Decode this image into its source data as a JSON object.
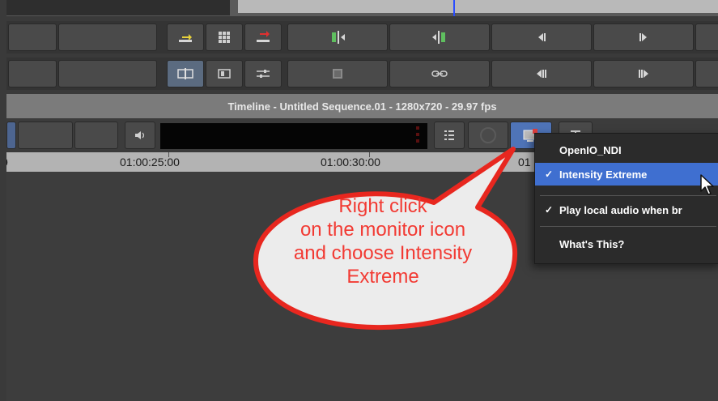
{
  "window": {
    "title": "Timeline - Untitled Sequence.01 - 1280x720 - 29.97 fps"
  },
  "ruler": {
    "timecodes": [
      "0",
      "01:00:25:00",
      "01:00:30:00",
      "01"
    ]
  },
  "context_menu": {
    "items": [
      {
        "label": "OpenIO_NDI",
        "checked": false,
        "highlighted": false
      },
      {
        "label": "Intensity Extreme",
        "checked": true,
        "highlighted": true
      },
      {
        "label": "Play local audio when br",
        "checked": true,
        "highlighted": false
      },
      {
        "label": "What's This?",
        "checked": false,
        "highlighted": false
      }
    ],
    "check_mark": "✓"
  },
  "callout": {
    "lines": [
      "Right click",
      "on the monitor icon",
      "and choose Intensity",
      "Extreme"
    ],
    "text_color": "#f23a33",
    "border_color": "#e8271f"
  },
  "colors": {
    "menu_highlight": "#3f6fd0",
    "playhead": "#2a4dff",
    "monitor_icon_accent": "#e04040"
  },
  "icons": {
    "row1": [
      "lift-icon",
      "grid-icon",
      "extract-icon",
      "splice-in-icon",
      "overwrite-icon",
      "step-back-icon",
      "step-forward-icon"
    ],
    "row2": [
      "monitor-split-icon",
      "monitor-single-icon",
      "sliders-icon",
      "clip-frame-icon",
      "link-icon",
      "frame-back-icon",
      "frame-forward-icon"
    ],
    "toolbar": [
      "speaker-icon",
      "menu-list-icon",
      "record-icon",
      "video-monitor-icon",
      "text-tool-icon"
    ]
  }
}
